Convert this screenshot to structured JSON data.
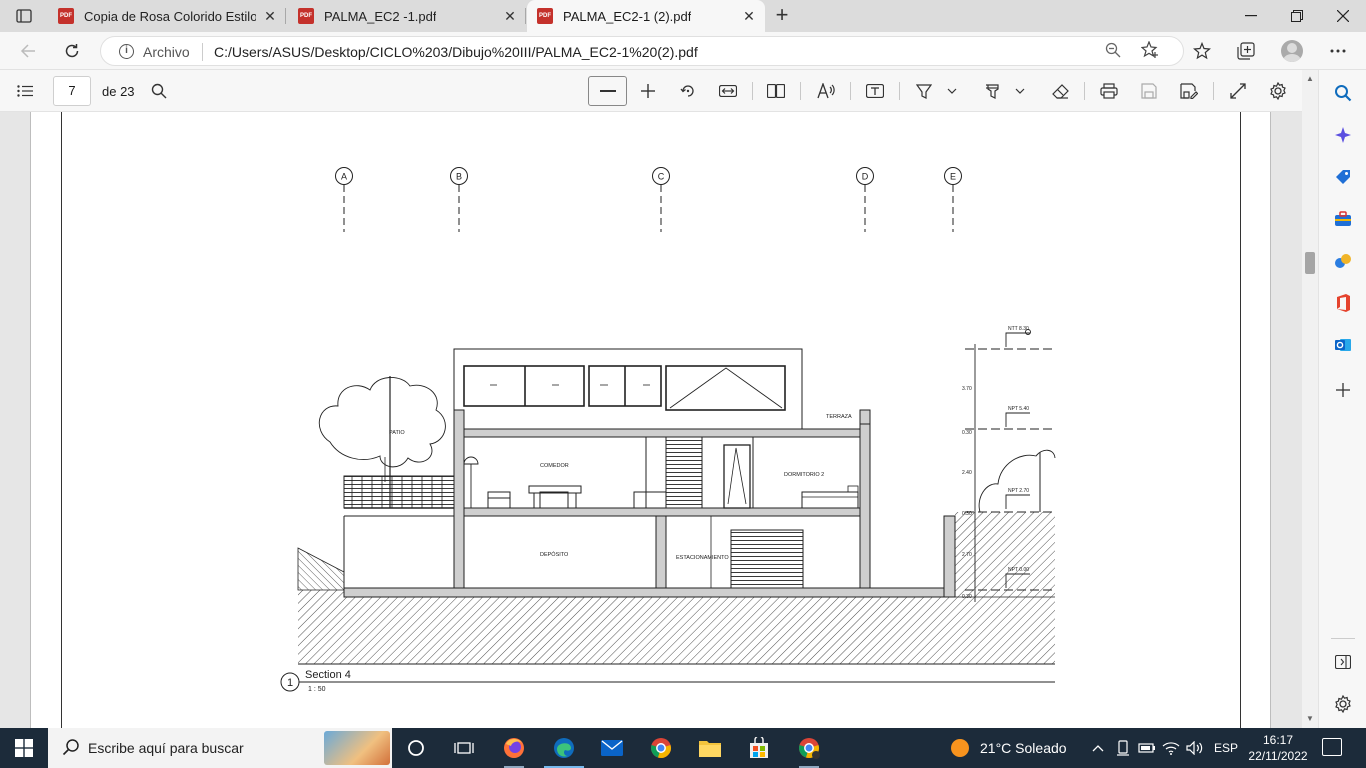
{
  "browser": {
    "tabs": [
      {
        "title": "Copia de Rosa Colorido Estilo Se",
        "icon": "pdf-icon"
      },
      {
        "title": "PALMA_EC2 -1.pdf",
        "icon": "pdf-icon"
      },
      {
        "title": "PALMA_EC2-1 (2).pdf",
        "icon": "pdf-icon",
        "active": true
      }
    ],
    "pdf_badge": "PDF",
    "address": {
      "scheme_label": "Archivo",
      "url": "C:/Users/ASUS/Desktop/CICLO%203/Dibujo%20III/PALMA_EC2-1%20(2).pdf"
    }
  },
  "pdf_toolbar": {
    "current_page": "7",
    "total_pages": "de 23"
  },
  "drawing": {
    "grid_labels": [
      "A",
      "B",
      "C",
      "D",
      "E"
    ],
    "rooms": {
      "patio": "PATIO",
      "comedor": "COMEDOR",
      "dormitorio": "DORMITORIO 2",
      "terraza": "TERRAZA",
      "deposito": "DEPÓSITO",
      "estacionamiento": "ESTACIONAMIENTO"
    },
    "levels": [
      "NTT 8.30",
      "NPT 5.40",
      "NPT 2.70",
      "NPT 0.00"
    ],
    "dims": [
      "3.70",
      "0.30",
      "2.40",
      "0.30",
      "2.70",
      "0.30"
    ],
    "section_number": "1",
    "section_title": "Section 4",
    "section_scale": "1 : 50"
  },
  "taskbar": {
    "search_placeholder": "Escribe aquí para buscar",
    "weather": "21°C  Soleado",
    "language": "ESP",
    "time": "16:17",
    "date": "22/11/2022"
  },
  "colors": {
    "tabstrip": "#dcdcdc",
    "taskbar": "#1c2b3a",
    "pdf_red": "#c4312b",
    "edge_blue": "#0f6cbd"
  }
}
